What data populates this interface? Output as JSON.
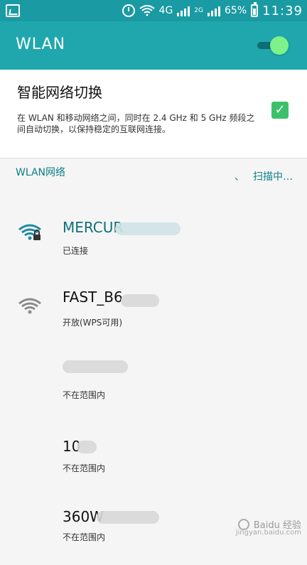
{
  "statusbar": {
    "network": "4G",
    "sim1": "4G",
    "sim2": "2G",
    "battery": "65%",
    "time": "11:39",
    "icons": [
      "gallery-icon",
      "alarm-icon",
      "wifi-icon",
      "signal-icon",
      "battery-icon"
    ]
  },
  "appbar": {
    "title": "WLAN",
    "toggle_on": true,
    "accent": "#1fa7ad"
  },
  "smart_switch": {
    "title": "智能网络切换",
    "description": "在 WLAN 和移动网络之间，同时在 2.4 GHz 和 5 GHz 频段之间自动切换，以保持稳定的互联网连接。",
    "checked": true,
    "checkbox_color": "#3cc16a"
  },
  "networks_section": {
    "title": "WLAN网络",
    "status": "扫描中…"
  },
  "networks": [
    {
      "name": "MERCUR",
      "status": "已连接",
      "icon": "wifi-lock-icon"
    },
    {
      "name": "FAST_B6",
      "status": "开放(WPS可用)",
      "icon": "wifi-icon"
    },
    {
      "name": "",
      "status": "不在范围内",
      "icon": ""
    },
    {
      "name": "10",
      "status": "不在范围内",
      "icon": ""
    },
    {
      "name": "360W",
      "status": "不在范围内",
      "icon": ""
    }
  ],
  "watermark": {
    "text": "Baidu 经验",
    "subtext": "jingyan.baidu.com"
  }
}
